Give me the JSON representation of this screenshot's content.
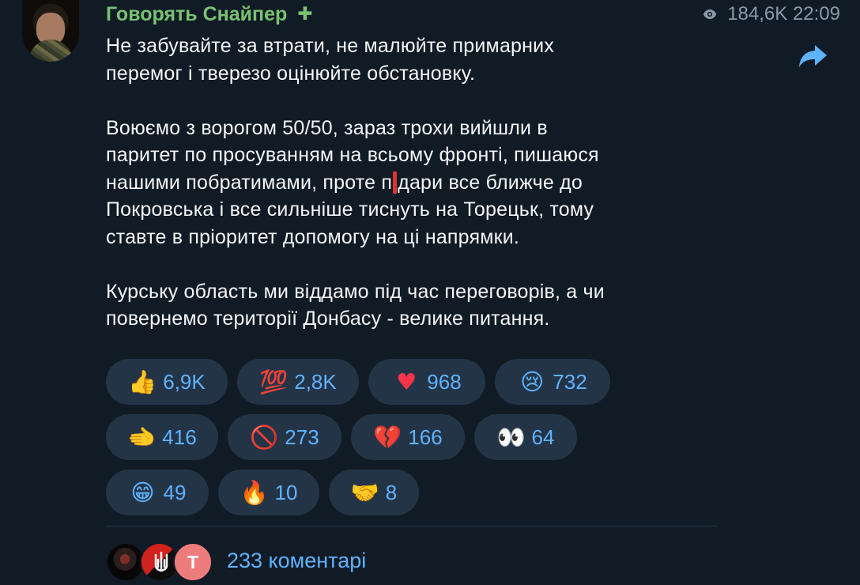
{
  "post": {
    "sender": "Говорять Снайпер",
    "badge_icon": "plus-icon",
    "views": "184,6K",
    "time": "22:09",
    "message": {
      "paragraph1": "Не забувайте за втрати, не малюйте примарних\nперемог і тверезо оцінюйте обстановку.",
      "paragraph2_before_cursor": "Воюємо з ворогом 50/50, зараз трохи вийшли в\nпаритет по просуванням на всьому фронті, пишаюся\nнашими побратимами, проте п",
      "paragraph2_after_cursor": "дари все ближче до\nПокровська і все сильніше тиснуть на Торецьк, тому\nставте в пріоритет допомогу на ці напрямки.",
      "paragraph3": "Курську область ми віддамо під час переговорів, а чи\nповернемо території Донбасу - велике питання."
    },
    "reactions": [
      [
        {
          "emoji": "👍",
          "count": "6,9K"
        },
        {
          "emoji": "💯",
          "count": "2,8K"
        },
        {
          "emoji": "♥",
          "count": "968"
        },
        {
          "emoji": "😢",
          "count": "732"
        }
      ],
      [
        {
          "emoji": "🫲",
          "count": "416"
        },
        {
          "emoji": "🚫",
          "count": "273"
        },
        {
          "emoji": "💔",
          "count": "166"
        },
        {
          "emoji": "👀",
          "count": "64"
        }
      ],
      [
        {
          "emoji": "😁",
          "count": "49"
        },
        {
          "emoji": "🔥",
          "count": "10"
        },
        {
          "emoji": "🤝",
          "count": "8"
        }
      ]
    ],
    "comments": {
      "third_avatar_letter": "Т",
      "label": "233 коментарі"
    }
  },
  "colors": {
    "background": "#111b26",
    "sender": "#78c271",
    "meta": "#8c99a8",
    "accent": "#5eb3ff",
    "reaction_background": "#243447"
  }
}
